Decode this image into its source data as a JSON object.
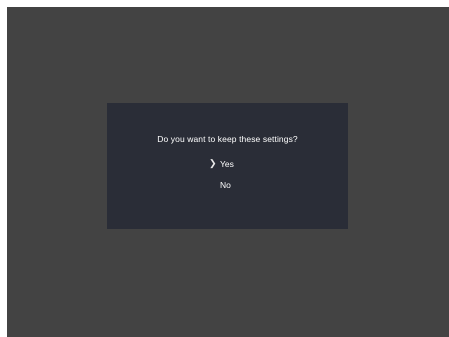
{
  "dialog": {
    "question": "Do you want to keep these settings?",
    "options": [
      {
        "label": "Yes",
        "selected": true
      },
      {
        "label": "No",
        "selected": false
      }
    ],
    "selection_cursor": "❯"
  },
  "colors": {
    "screen_background": "#434343",
    "dialog_background": "#2a2d37",
    "text": "#ffffff"
  }
}
